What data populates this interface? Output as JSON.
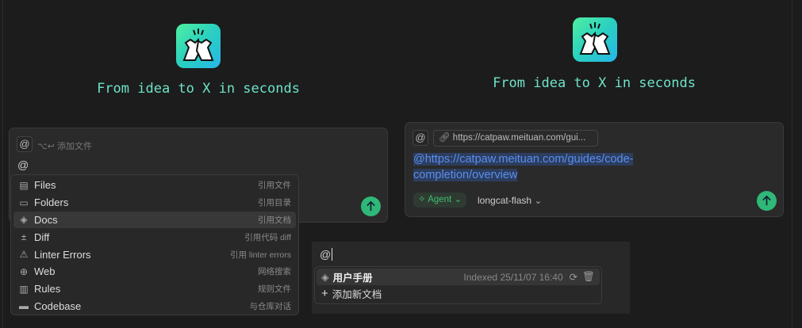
{
  "left": {
    "tagline": "From idea to X in seconds",
    "input": {
      "at_chip": "@",
      "hint": "⌥↩ 添加文件",
      "typed": "@"
    },
    "menu": [
      {
        "icon": "file-icon",
        "glyph": "▤",
        "label": "Files",
        "desc": "引用文件"
      },
      {
        "icon": "folder-icon",
        "glyph": "▭",
        "label": "Folders",
        "desc": "引用目录"
      },
      {
        "icon": "layers-icon",
        "glyph": "◈",
        "label": "Docs",
        "desc": "引用文档",
        "selected": true
      },
      {
        "icon": "diff-icon",
        "glyph": "±",
        "label": "Diff",
        "desc": "引用代码 diff"
      },
      {
        "icon": "warning-icon",
        "glyph": "⚠",
        "label": "Linter Errors",
        "desc": "引用 linter errors"
      },
      {
        "icon": "globe-icon",
        "glyph": "⊕",
        "label": "Web",
        "desc": "网络搜索"
      },
      {
        "icon": "rules-icon",
        "glyph": "▥",
        "label": "Rules",
        "desc": "规则文件"
      },
      {
        "icon": "codebase-icon",
        "glyph": "▬",
        "label": "Codebase",
        "desc": "与仓库对话"
      }
    ]
  },
  "right": {
    "tagline": "From idea to X in seconds",
    "at_chip": "@",
    "url_chip": "https://catpaw.meituan.com/gui...",
    "mention_line1": " @https://catpaw.meituan.com/guides/code-",
    "mention_line2": "completion/overview ",
    "agent_label": "Agent",
    "model_label": "longcat-flash"
  },
  "docs_panel": {
    "typed": "@",
    "doc_name": "用户手册",
    "indexed": "Indexed 25/11/07 16:40",
    "add_label": "添加新文档"
  },
  "colors": {
    "accent": "#2fb877",
    "tagline": "#6fe3c8",
    "mention": "#5b8ff0"
  }
}
